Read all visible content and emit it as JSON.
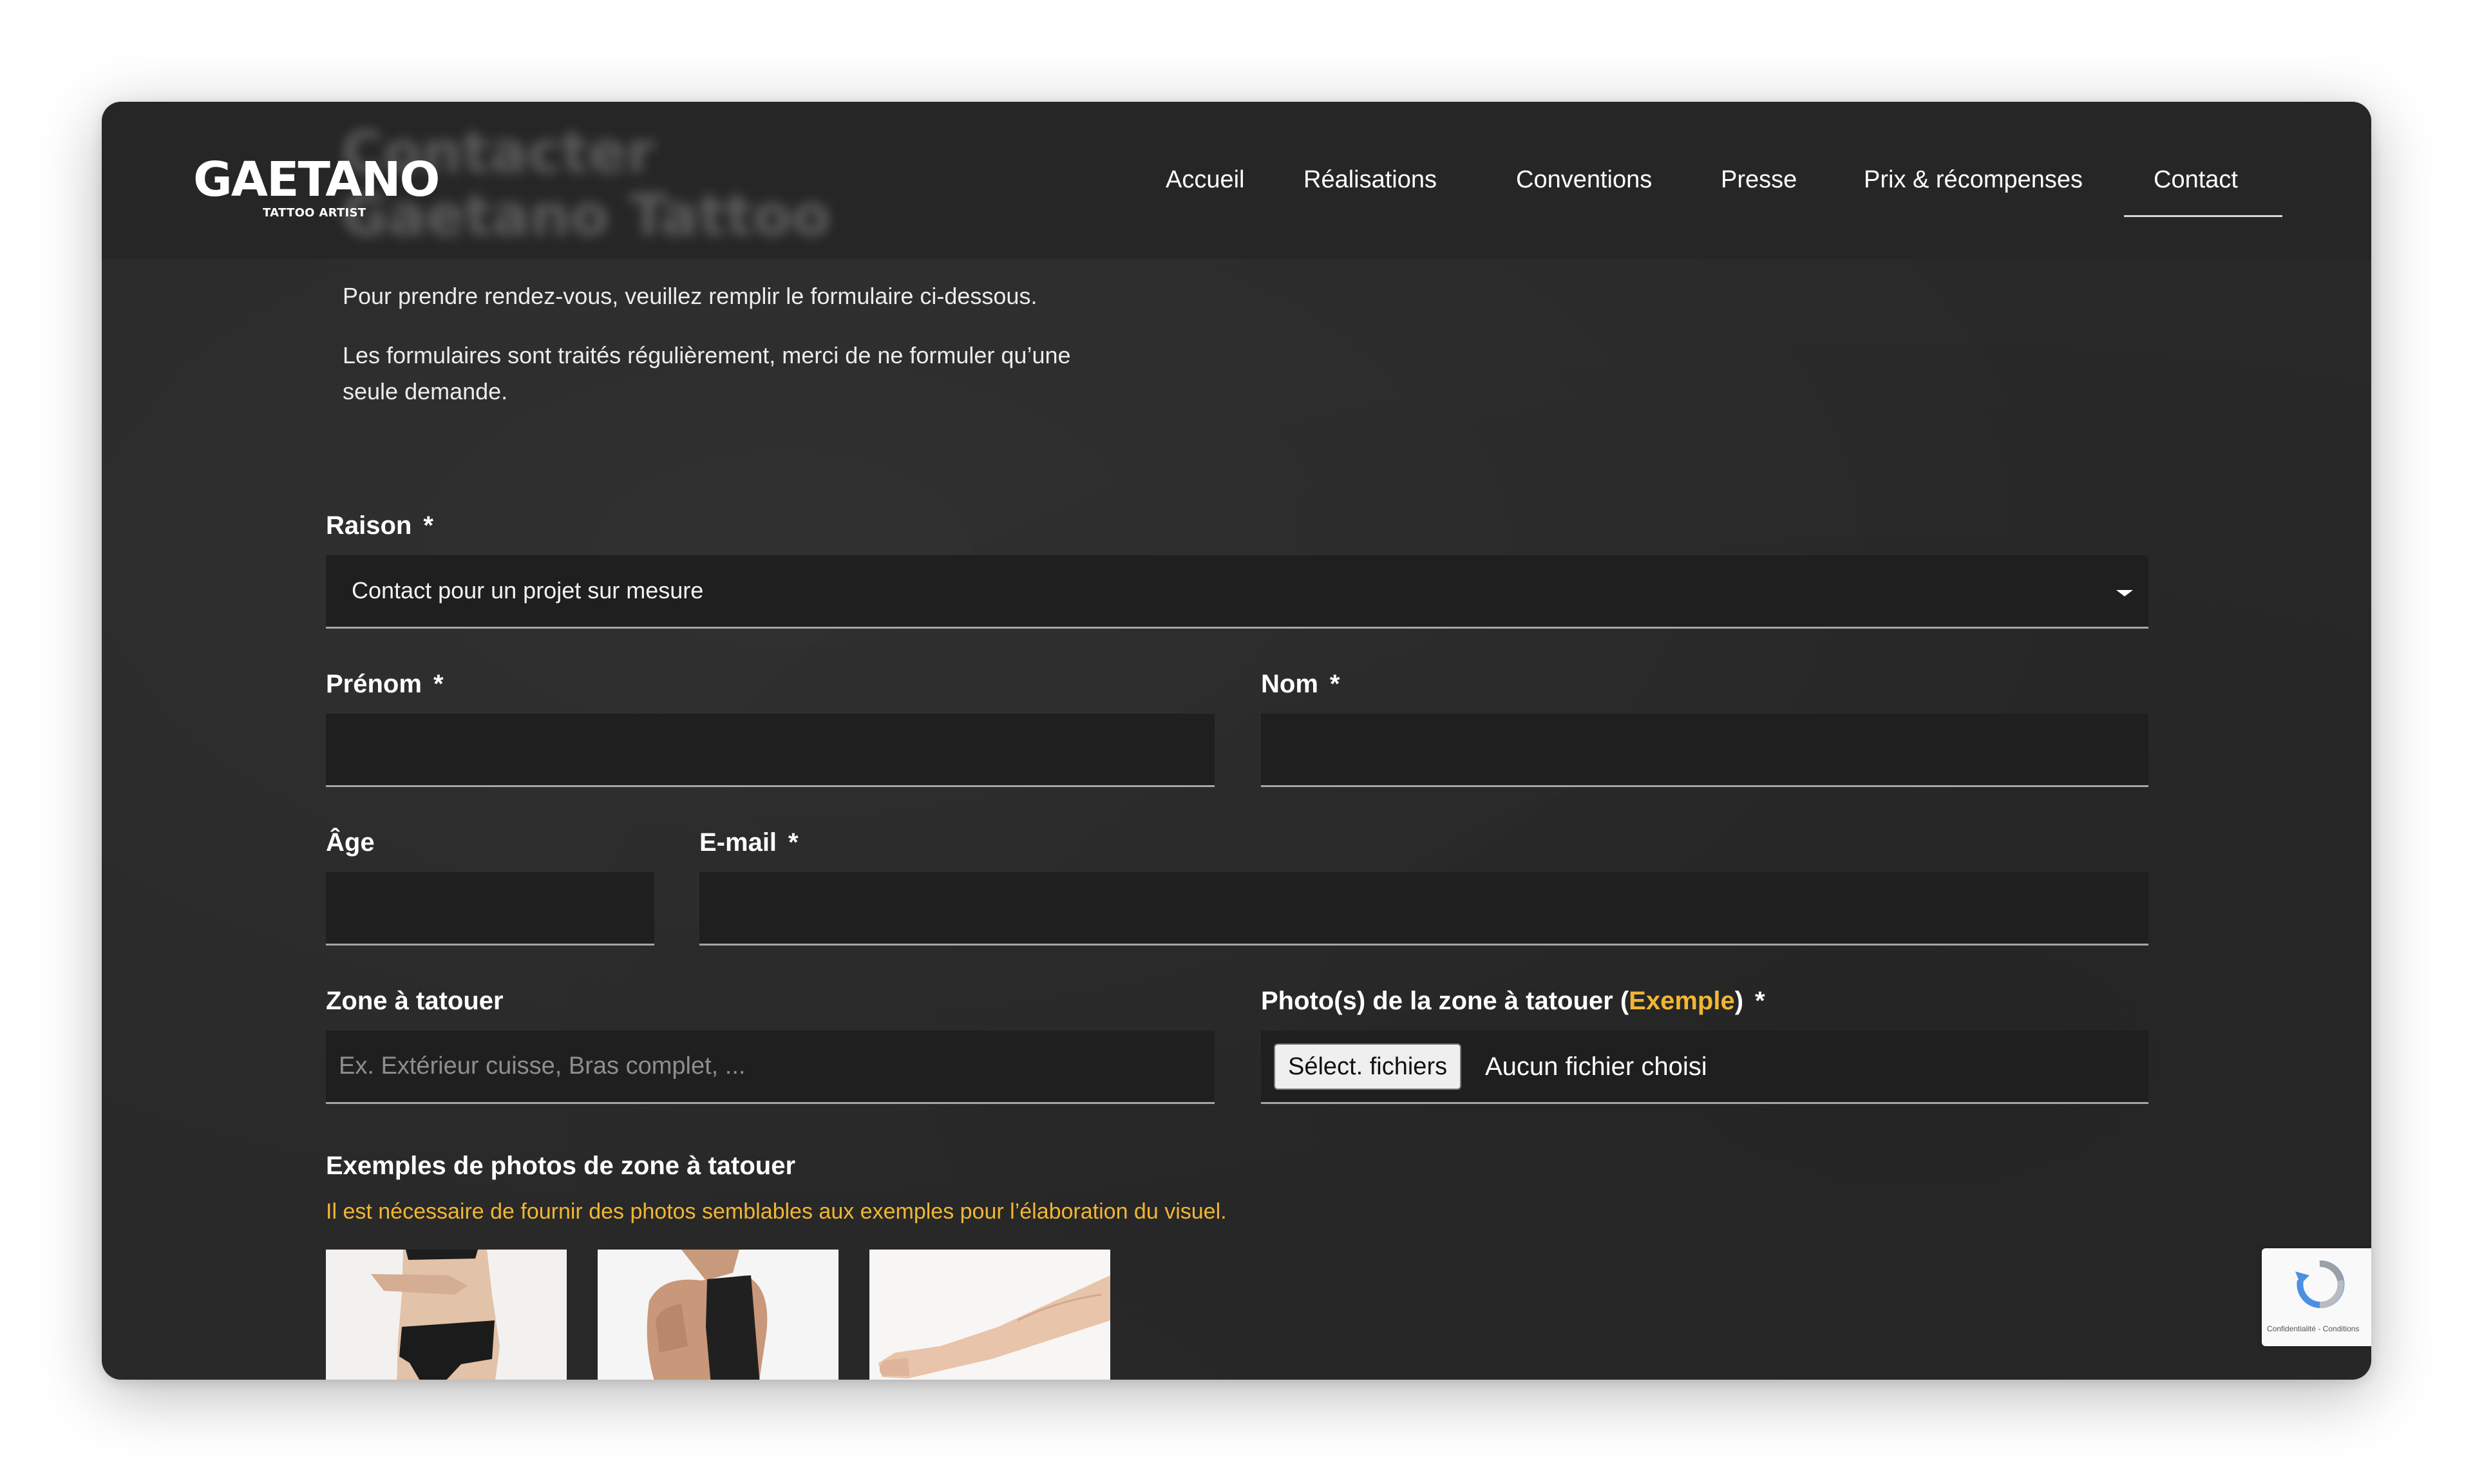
{
  "brand": {
    "name": "GAETANO",
    "tagline": "TATTOO ARTIST"
  },
  "hero": {
    "title_line1": "Contacter",
    "title_line2": "Gaetano Tattoo"
  },
  "nav": {
    "items": [
      {
        "label": "Accueil"
      },
      {
        "label": "Réalisations"
      },
      {
        "label": "Conventions"
      },
      {
        "label": "Presse"
      },
      {
        "label": "Prix & récompenses"
      },
      {
        "label": "Contact",
        "active": true
      }
    ]
  },
  "intro": {
    "line1": "Pour prendre rendez-vous, veuillez remplir le formulaire ci-dessous.",
    "line2a": "Les formulaires sont traités régulièrement, merci de ne formuler qu’une",
    "line2b": "seule demande."
  },
  "form": {
    "reason": {
      "label": "Raison",
      "required": "*",
      "value": "Contact pour un projet sur mesure"
    },
    "firstname": {
      "label": "Prénom",
      "required": "*",
      "value": ""
    },
    "lastname": {
      "label": "Nom",
      "required": "*",
      "value": ""
    },
    "age": {
      "label": "Âge",
      "value": ""
    },
    "email": {
      "label": "E-mail",
      "required": "*",
      "value": ""
    },
    "zone": {
      "label": "Zone à tatouer",
      "placeholder": "Ex. Extérieur cuisse, Bras complet, ..."
    },
    "photos": {
      "label_before": "Photo(s) de la zone à tatouer (",
      "label_link": "Exemple",
      "label_after": ")",
      "required": "*",
      "button_label": "Sélect. fichiers",
      "status": "Aucun fichier choisi"
    }
  },
  "examples": {
    "heading": "Exemples de photos de zone à tatouer",
    "note": "Il est nécessaire de fournir des photos semblables aux exemples pour l’élaboration du visuel."
  },
  "recaptcha": {
    "footer": "Confidentialité - Conditions"
  },
  "colors": {
    "background": "#292929",
    "header": "#262626",
    "field": "#1f1f1f",
    "accent": "#f2b632",
    "text": "#ffffff"
  }
}
